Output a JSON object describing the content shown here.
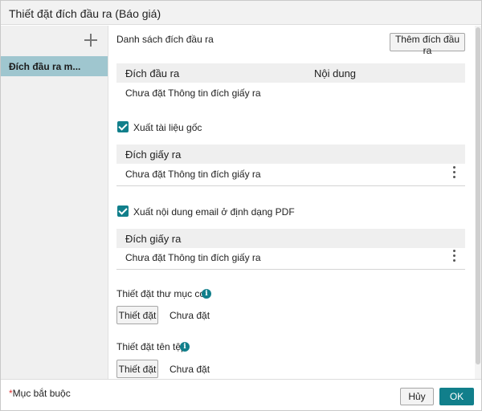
{
  "dialog": {
    "title": "Thiết đặt đích đầu ra (Báo giá)"
  },
  "sidebar": {
    "add_icon": "plus-icon",
    "items": [
      {
        "label": "Đích đầu ra m..."
      }
    ]
  },
  "main": {
    "dest_list_label": "Danh sách đích đầu ra",
    "add_dest_button": "Thêm đích đầu ra",
    "dest_table": {
      "col1": "Đích đầu ra",
      "col2": "Nội dung",
      "row_text": "Chưa đặt Thông tin đích giấy ra"
    },
    "original_doc": {
      "checkbox_label": "Xuất tài liệu gốc",
      "table_header": "Đích giấy ra",
      "row_text": "Chưa đặt Thông tin đích giấy ra"
    },
    "email_pdf": {
      "checkbox_label": "Xuất nội dung email ở định dạng PDF",
      "table_header": "Đích giấy ra",
      "row_text": "Chưa đặt Thông tin đích giấy ra"
    },
    "subfolder": {
      "label": "Thiết đặt thư mục con",
      "button": "Thiết đặt",
      "status": "Chưa đặt"
    },
    "filename": {
      "label": "Thiết đặt tên tệp",
      "button": "Thiết đặt",
      "status": "Chưa đặt"
    }
  },
  "footer": {
    "required_star": "*",
    "required_text": "Mục bắt buộc",
    "cancel": "Hủy",
    "ok": "OK"
  },
  "colors": {
    "accent": "#117f8b",
    "selected_item": "#9fc6cf"
  }
}
